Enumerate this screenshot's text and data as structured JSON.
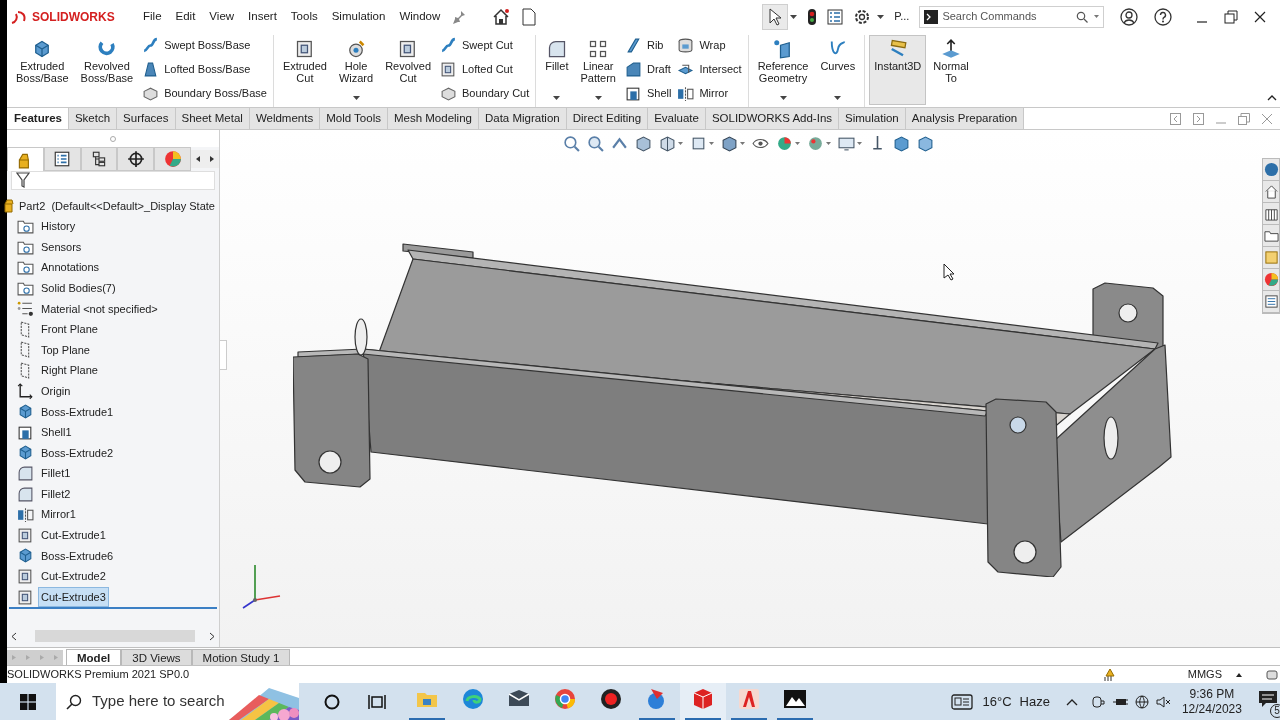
{
  "app": {
    "logo": "SOLIDWORKS"
  },
  "menu": [
    "File",
    "Edit",
    "View",
    "Insert",
    "Tools",
    "Simulation",
    "Window"
  ],
  "quick_access": {
    "overflow": "P..."
  },
  "search": {
    "placeholder": "Search Commands"
  },
  "ribbon": [
    {
      "large": [
        {
          "label": "Extruded Boss/Base",
          "dropdown": false,
          "selected": false
        },
        {
          "label": "Revolved Boss/Base",
          "dropdown": false,
          "selected": false
        }
      ],
      "small": [
        [
          "Swept Boss/Base",
          "Lofted Boss/Base",
          "Boundary Boss/Base"
        ]
      ]
    },
    {
      "large": [
        {
          "label": "Extruded Cut",
          "dropdown": false,
          "selected": false
        },
        {
          "label": "Hole Wizard",
          "dropdown": true,
          "selected": false
        },
        {
          "label": "Revolved Cut",
          "dropdown": false,
          "selected": false
        }
      ],
      "small": [
        [
          "Swept Cut",
          "Lofted Cut",
          "Boundary Cut"
        ]
      ]
    },
    {
      "large": [
        {
          "label": "Fillet",
          "dropdown": true,
          "selected": false
        },
        {
          "label": "Linear Pattern",
          "dropdown": true,
          "selected": false
        }
      ],
      "small": [
        [
          "Rib",
          "Draft",
          "Shell"
        ],
        [
          "Wrap",
          "Intersect",
          "Mirror"
        ]
      ]
    },
    {
      "large": [
        {
          "label": "Reference Geometry",
          "dropdown": true,
          "selected": false
        },
        {
          "label": "Curves",
          "dropdown": true,
          "selected": false
        }
      ]
    },
    {
      "large": [
        {
          "label": "Instant3D",
          "dropdown": false,
          "selected": true
        },
        {
          "label": "Normal To",
          "dropdown": false,
          "selected": false
        }
      ]
    }
  ],
  "tabs": [
    {
      "label": "Features",
      "selected": true
    },
    {
      "label": "Sketch",
      "selected": false
    },
    {
      "label": "Surfaces",
      "selected": false
    },
    {
      "label": "Sheet Metal",
      "selected": false
    },
    {
      "label": "Weldments",
      "selected": false
    },
    {
      "label": "Mold Tools",
      "selected": false
    },
    {
      "label": "Mesh Modeling",
      "selected": false
    },
    {
      "label": "Data Migration",
      "selected": false
    },
    {
      "label": "Direct Editing",
      "selected": false
    },
    {
      "label": "Evaluate",
      "selected": false
    },
    {
      "label": "SOLIDWORKS Add-Ins",
      "selected": false
    },
    {
      "label": "Simulation",
      "selected": false
    },
    {
      "label": "Analysis Preparation",
      "selected": false
    }
  ],
  "tree": {
    "root": "Part2  (Default<<Default>_Display State",
    "items": [
      {
        "label": "History",
        "kind": "folder",
        "selected": false
      },
      {
        "label": "Sensors",
        "kind": "folder",
        "selected": false
      },
      {
        "label": "Annotations",
        "kind": "folder",
        "selected": false
      },
      {
        "label": "Solid Bodies(7)",
        "kind": "folder",
        "selected": false
      },
      {
        "label": "Material <not specified>",
        "kind": "material",
        "selected": false
      },
      {
        "label": "Front Plane",
        "kind": "plane",
        "selected": false
      },
      {
        "label": "Top Plane",
        "kind": "plane",
        "selected": false
      },
      {
        "label": "Right Plane",
        "kind": "plane",
        "selected": false
      },
      {
        "label": "Origin",
        "kind": "origin",
        "selected": false
      },
      {
        "label": "Boss-Extrude1",
        "kind": "extrude",
        "selected": false
      },
      {
        "label": "Shell1",
        "kind": "shell",
        "selected": false
      },
      {
        "label": "Boss-Extrude2",
        "kind": "extrude",
        "selected": false
      },
      {
        "label": "Fillet1",
        "kind": "fillet",
        "selected": false
      },
      {
        "label": "Fillet2",
        "kind": "fillet",
        "selected": false
      },
      {
        "label": "Mirror1",
        "kind": "mirror",
        "selected": false
      },
      {
        "label": "Cut-Extrude1",
        "kind": "cut",
        "selected": false
      },
      {
        "label": "Boss-Extrude6",
        "kind": "extrude",
        "selected": false
      },
      {
        "label": "Cut-Extrude2",
        "kind": "cut",
        "selected": false
      },
      {
        "label": "Cut-Extrude3",
        "kind": "cut",
        "selected": true
      }
    ]
  },
  "bottom_tabs": [
    {
      "label": "Model",
      "selected": true
    },
    {
      "label": "3D Views",
      "selected": false
    },
    {
      "label": "Motion Study 1",
      "selected": false
    }
  ],
  "status_bar": {
    "version": "SOLIDWORKS Premium 2021 SP0.0",
    "units": "MMGS"
  },
  "taskbar": {
    "search_placeholder": "Type here to search",
    "apps": [
      {
        "running": true,
        "active": false
      },
      {
        "running": false,
        "active": false
      },
      {
        "running": false,
        "active": false
      },
      {
        "running": false,
        "active": false
      },
      {
        "running": false,
        "active": false
      },
      {
        "running": true,
        "active": false
      },
      {
        "running": true,
        "active": true
      },
      {
        "running": true,
        "active": false
      },
      {
        "running": true,
        "active": false
      }
    ],
    "temperature": "16°C",
    "weather": "Haze",
    "time": "9:36 PM",
    "date": "12/24/2023",
    "notifications": "5"
  }
}
